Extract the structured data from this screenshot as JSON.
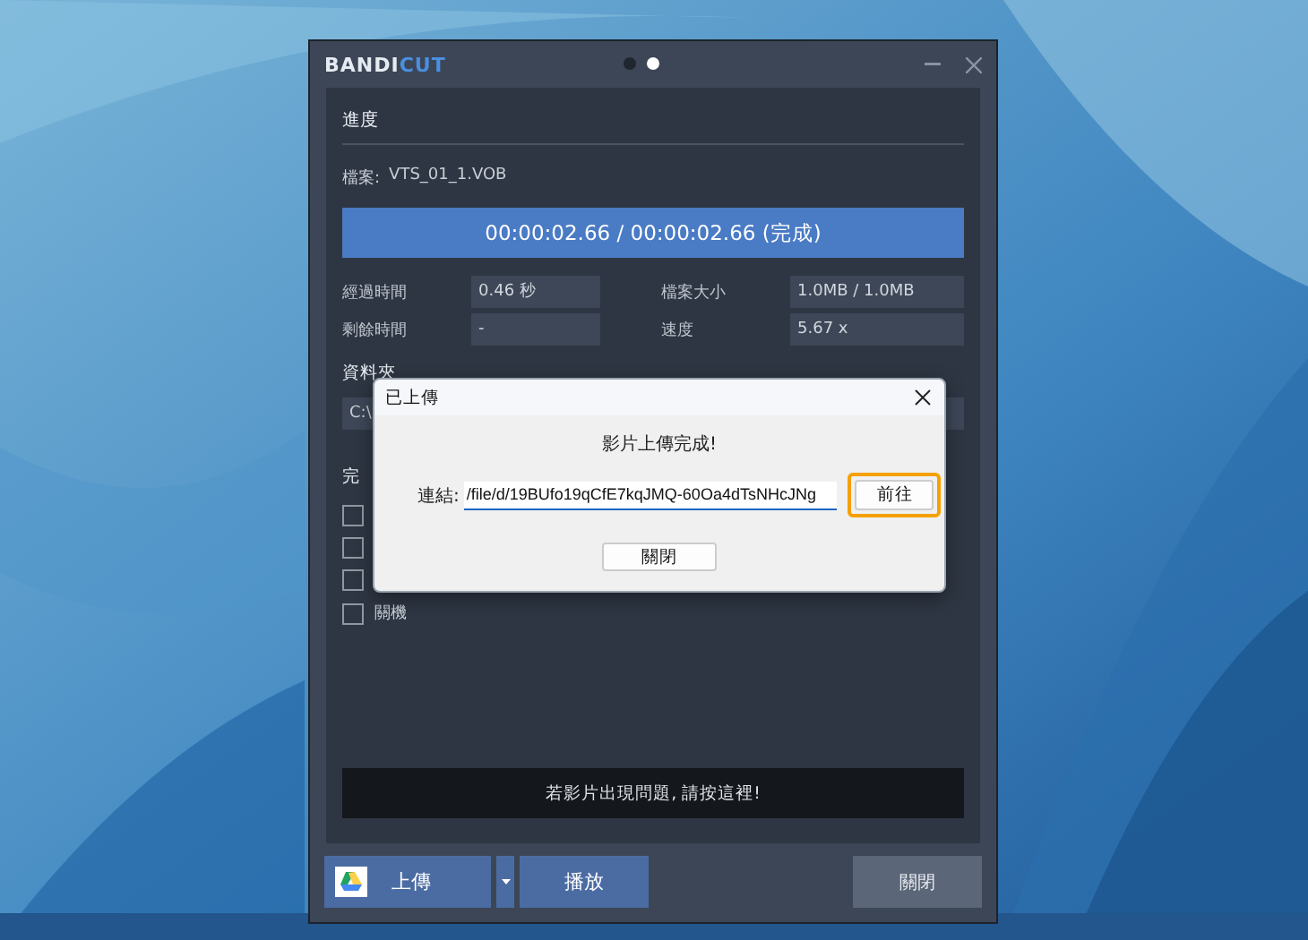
{
  "window": {
    "logo": [
      "BANDI",
      "CUT"
    ],
    "page_dots": [
      {
        "selected": false
      },
      {
        "selected": true
      }
    ]
  },
  "progress": {
    "heading": "進度",
    "file_label": "檔案:",
    "file_name": "VTS_01_1.VOB",
    "bar_text": "00:00:02.66 / 00:00:02.66 (完成)",
    "level": 1
  },
  "stats": [
    {
      "label": "經過時間",
      "value": "0.46 秒"
    },
    {
      "label": "檔案大小",
      "value": "1.0MB / 1.0MB"
    },
    {
      "label": "剩餘時間",
      "value": "-"
    },
    {
      "label": "速度",
      "value": "5.67 x"
    }
  ],
  "folder": {
    "heading": "資料夾",
    "path": "C:\\"
  },
  "on_complete": {
    "heading": "完",
    "options": [
      {
        "checked": false
      },
      {
        "checked": false
      },
      {
        "checked": false
      },
      {
        "label": "關機",
        "checked": false
      }
    ]
  },
  "help_bar": "若影片出現問題, 請按這裡!",
  "buttons": {
    "upload": "上傳",
    "play": "播放",
    "close": "關閉"
  },
  "dialog": {
    "title": "已上傳",
    "message": "影片上傳完成!",
    "link_label": "連結:",
    "link_value": "/file/d/19BUfo19qCfE7kqJMQ-60Oa4dTsNHcJNg",
    "go": "前往",
    "close": "關閉"
  }
}
